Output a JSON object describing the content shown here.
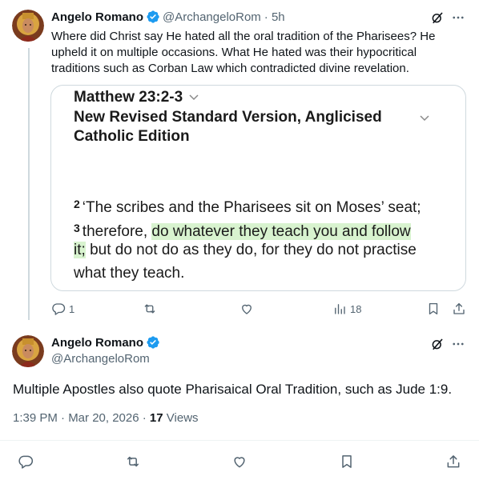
{
  "tweet1": {
    "author_name": "Angelo Romano",
    "author_handle": "@ArchangeloRom",
    "time": "· 5h",
    "text": "Where did Christ say He hated all the oral tradition of the Pharisees? He upheld it on multiple occasions. What He hated was their hypocritical traditions such as Corban Law which contradicted divine revelation.",
    "media": {
      "reference": "Matthew 23:2-3",
      "version": "New Revised Standard Version, Anglicised Catholic Edition",
      "verse2_num": "2",
      "verse2_text": "‘The scribes and the Pharisees sit on Moses’ seat;",
      "verse3_num": "3",
      "verse3_pre": "therefore,",
      "verse3_hl1": "do whatever they teach you and follow",
      "verse3_hl2": "it;",
      "verse3_post1": "but do not do as they do, for they do not practise",
      "verse3_post2": "what they teach."
    },
    "actions": {
      "reply_count": "1",
      "retweet_count": "",
      "like_count": "",
      "views_count": "18"
    }
  },
  "tweet2": {
    "author_name": "Angelo Romano",
    "author_handle": "@ArchangeloRom",
    "text": "Multiple Apostles also quote Pharisaical Oral Tradition, such as Jude 1:9.",
    "timestamp": "1:39 PM · Mar 20, 2026 ·",
    "views_count": "17",
    "views_label": "Views"
  },
  "icons": {
    "verified": "verified-badge-icon",
    "grok": "grok-icon",
    "more": "more-icon",
    "reply": "reply-icon",
    "retweet": "retweet-icon",
    "like": "like-icon",
    "views": "views-icon",
    "bookmark": "bookmark-icon",
    "share": "share-icon"
  },
  "colors": {
    "accent": "#1d9bf0",
    "text_primary": "#0f1419",
    "text_secondary": "#536471",
    "highlight": "#d8f3cf"
  }
}
